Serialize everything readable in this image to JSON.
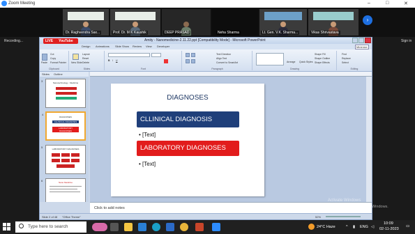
{
  "zoom": {
    "window_title": "Zoom Meeting",
    "recording_label": "Recording...",
    "sign_in": "Sign in",
    "participants": [
      {
        "name": "Dr. Raghvendra Sax..."
      },
      {
        "name": "Prof. Dr. M K Kaushik"
      },
      {
        "name": "DEEP PRASAD"
      },
      {
        "name": "Neha Sharma"
      },
      {
        "name": "Lt. Gen. V.K. Sharma..."
      },
      {
        "name": "Vikas Shrivastava"
      }
    ],
    "next_icon": "chevron-right-icon"
  },
  "ppt": {
    "window_title": "Amity - Nanomedicine-2.11.22.ppt [Compatibility Mode] - Microsoft PowerPoint",
    "youtube_tab": {
      "live": "LIVE",
      "label": "YouTube"
    },
    "menu": [
      "Design",
      "Animations",
      "Slide Show",
      "Review",
      "View",
      "Developer"
    ],
    "minimize_label": "Minimize",
    "ribbon_groups": [
      "Clipboard",
      "Slides",
      "Font",
      "Paragraph",
      "Drawing",
      "Editing"
    ],
    "ribbon_items": {
      "cut": "Cut",
      "copy": "Copy",
      "format_painter": "Format Painter",
      "paste": "Paste",
      "layout": "Layout",
      "reset": "Reset",
      "delete": "Delete",
      "new_slide": "New Slide",
      "text_direction": "Text Direction",
      "align_text": "Align Text",
      "convert": "Convert to SmartArt",
      "arrange": "Arrange",
      "quick_styles": "Quick Styles",
      "shape_fill": "Shape Fill",
      "shape_outline": "Shape Outline",
      "shape_effects": "Shape Effects",
      "find": "Find",
      "replace": "Replace",
      "select": "Select"
    },
    "panel_tabs": [
      "Slides",
      "Outline"
    ],
    "thumbnails": [
      {
        "number": "3",
        "title": "Nanotechnology - Medicine",
        "selected": false
      },
      {
        "number": "4",
        "title": "DIAGNOSES",
        "subtitle_1": "CLLINICAL DIAGNOSIS",
        "subtitle_2": "LABORATORY DIAGNOSES",
        "selected": true
      },
      {
        "number": "5",
        "title": "LABORATORY DIAGNOSES",
        "selected": false
      },
      {
        "number": "6",
        "title": "Nano Medicine",
        "selected": false
      }
    ],
    "slide": {
      "title": "DIAGNOSES",
      "heading_1": "CLLINICAL DIAGNOSIS",
      "bullet_1": "• [Text]",
      "heading_2": "LABORATORY DIAGNOSES",
      "bullet_2": "• [Text]",
      "heading_1_color": "#1f3f7a",
      "heading_2_color": "#e21c1c"
    },
    "notes_placeholder": "Click to add notes",
    "status": {
      "slide_pos": "Slide 2 of 48",
      "theme": "\"Office Theme\"",
      "zoom": "52%"
    }
  },
  "watermark": {
    "line1": "Activate Windows",
    "line2": "Go to Settings to activate Windows."
  },
  "taskbar": {
    "search_placeholder": "Type here to search",
    "weather": "24°C  Haze",
    "language": "ENG",
    "time": "10:09",
    "date": "02-11-2023"
  }
}
